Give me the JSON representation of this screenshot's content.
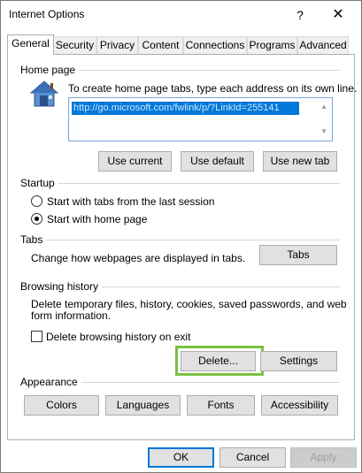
{
  "window": {
    "title": "Internet Options",
    "help_label": "?",
    "close_label": "✕"
  },
  "tabs": [
    {
      "label": "General",
      "active": true
    },
    {
      "label": "Security"
    },
    {
      "label": "Privacy"
    },
    {
      "label": "Content"
    },
    {
      "label": "Connections"
    },
    {
      "label": "Programs"
    },
    {
      "label": "Advanced"
    }
  ],
  "home_page": {
    "title": "Home page",
    "instruction": "To create home page tabs, type each address on its own line.",
    "url_value": "http://go.microsoft.com/fwlink/p/?LinkId=255141",
    "buttons": {
      "use_current": "Use current",
      "use_default": "Use default",
      "use_new_tab": "Use new tab"
    },
    "icon": "house-icon"
  },
  "startup": {
    "title": "Startup",
    "option_last_session": "Start with tabs from the last session",
    "option_home_page": "Start with home page",
    "selected": "home_page"
  },
  "tabs_section": {
    "title": "Tabs",
    "description": "Change how webpages are displayed in tabs.",
    "button": "Tabs"
  },
  "browsing_history": {
    "title": "Browsing history",
    "description_line1": "Delete temporary files, history, cookies, saved passwords, and web",
    "description_line2": "form information.",
    "checkbox_label": "Delete browsing history on exit",
    "checkbox_checked": false,
    "delete_button": "Delete...",
    "settings_button": "Settings",
    "highlight_color": "#7ac143"
  },
  "appearance": {
    "title": "Appearance",
    "colors": "Colors",
    "languages": "Languages",
    "fonts": "Fonts",
    "accessibility": "Accessibility"
  },
  "footer": {
    "ok": "OK",
    "cancel": "Cancel",
    "apply": "Apply"
  },
  "colors": {
    "accent": "#0078d7",
    "highlight": "#7ac143"
  }
}
